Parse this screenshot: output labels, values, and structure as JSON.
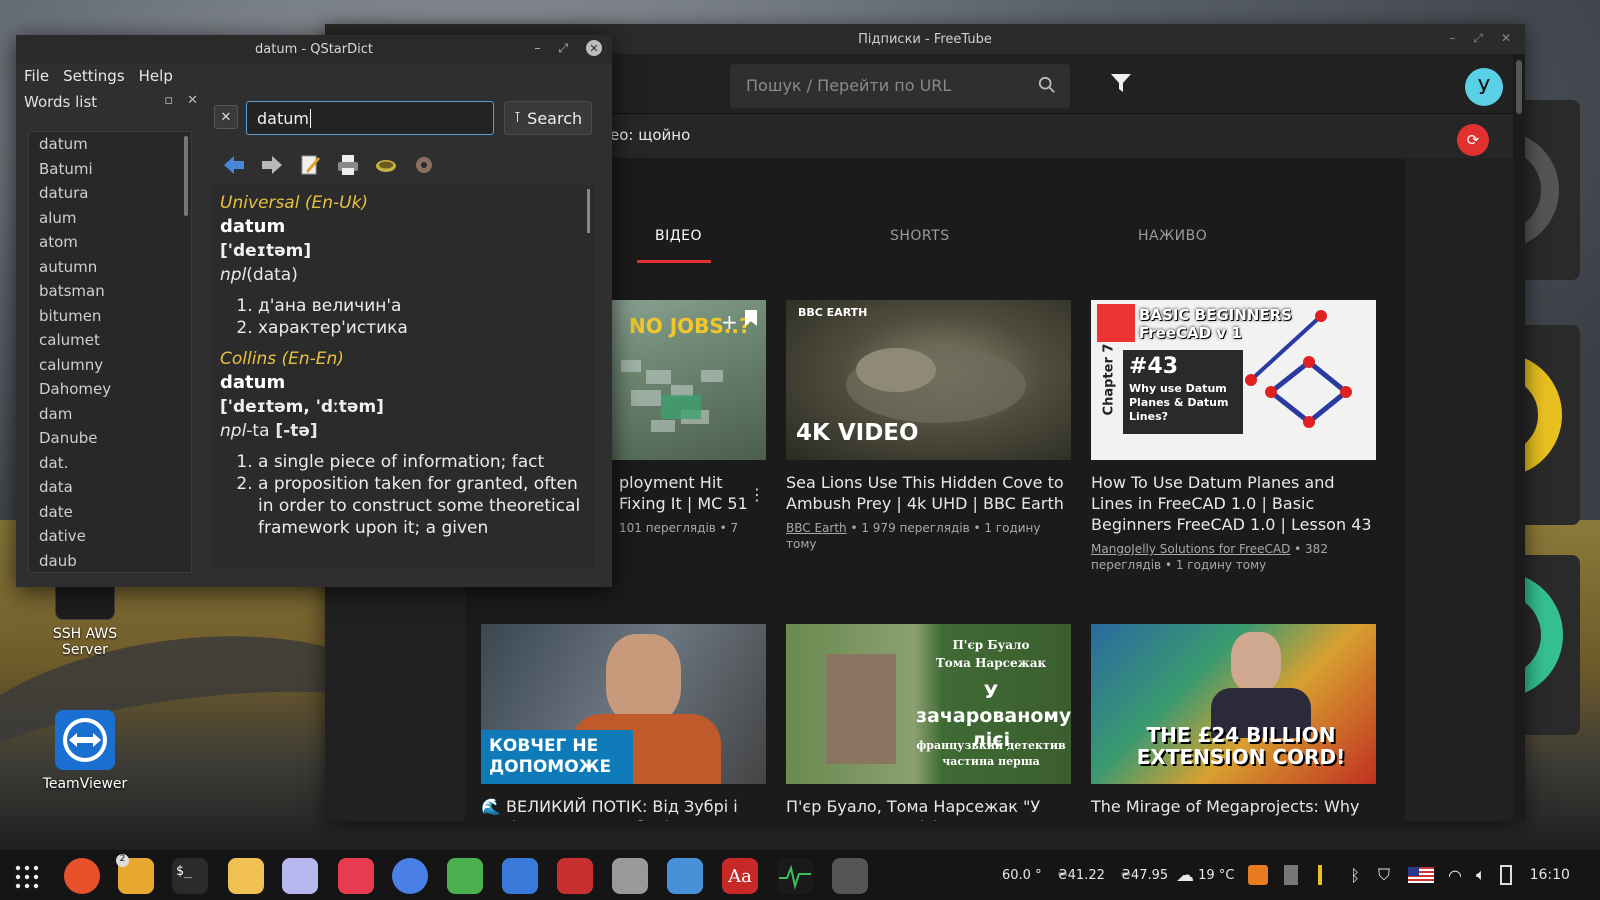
{
  "desktop": {
    "icons": [
      {
        "label": "SSH AWS Server"
      },
      {
        "label": "TeamViewer"
      }
    ]
  },
  "freetube": {
    "window_title": "Підписки - FreeTube",
    "search_placeholder": "Пошук / Перейти по URL",
    "avatar_letter": "У",
    "status_text": "ео: щойно",
    "tabs": [
      "ВІДЕО",
      "SHORTS",
      "НАЖИВО"
    ],
    "videos": [
      {
        "title": "ployment Hit\nFixing It | MC 51",
        "channel": "",
        "meta": "101 переглядів • 7",
        "thumb_text": "NO JOBS..?"
      },
      {
        "title": "Sea Lions Use This Hidden Cove to Ambush Prey | 4k UHD | BBC Earth",
        "channel": "BBC Earth",
        "meta": " • 1 979 переглядів • 1 годину тому",
        "thumb_text": "4K VIDEO",
        "thumb_badge": "BBC EARTH"
      },
      {
        "title": "How To Use Datum Planes and Lines in FreeCAD 1.0 | Basic Beginners FreeCAD 1.0 | Lesson 43",
        "channel": "MangoJelly Solutions for FreeCAD",
        "meta": " • 382 переглядів • 1 годину тому",
        "thumb_text": "BASIC BEGINNERS FreeCAD v 1",
        "thumb_num": "#43",
        "thumb_sub": "Why use Datum Planes & Datum Lines?",
        "thumb_chapter": "Chapter 7"
      },
      {
        "title": "🌊 ВЕЛИКИЙ ПОТІК: Від Зубрі і Сокільник до загибелі",
        "thumb_text": "КОВЧЕГ НЕ ДОПОМОЖЕ"
      },
      {
        "title": "П'єр Буало, Тома Нарсежак \"У зачарованому лісі\", переклад",
        "thumb_top": "П'єр Буало\nТома Нарсежак",
        "thumb_text": "У зачарованому лісі",
        "thumb_sub": "французький детектив\nчастина перша"
      },
      {
        "title": "The Mirage of Megaprojects: Why the West Keeps Getting",
        "thumb_text": "THE £24 BILLION EXTENSION CORD!"
      }
    ]
  },
  "qstardict": {
    "window_title": "datum - QStarDict",
    "menu": [
      "File",
      "Settings",
      "Help"
    ],
    "words_list_title": "Words list",
    "words": [
      "datum",
      "Batumi",
      "datura",
      "alum",
      "atom",
      "autumn",
      "batsman",
      "bitumen",
      "calumet",
      "calumny",
      "Dahomey",
      "dam",
      "Danube",
      "dat.",
      "data",
      "date",
      "dative",
      "daub"
    ],
    "search_value": "datum",
    "search_button": "Search",
    "entries": [
      {
        "dict": "Universal (En-Uk)",
        "word": "datum",
        "transcription": "['deɪtəm]",
        "gram_abbr": "npl",
        "gram_rest": "(data)",
        "senses": [
          "д'ана величин'а",
          "характер'истика"
        ]
      },
      {
        "dict": "Collins (En-En)",
        "word": "datum",
        "transcription": "['deɪtəm, 'dːtəm]",
        "gram_abbr": "npl",
        "gram_rest": "-ta",
        "gram_bold": " [-tə]",
        "senses": [
          "a single piece of information; fact",
          "a proposition taken for granted, often in order to construct some theoretical framework upon it; a given"
        ]
      }
    ]
  },
  "taskbar": {
    "tray": {
      "temp_cpu": "60.0 °",
      "price1": "₴41.22",
      "price2": "₴47.95",
      "weather": "19 °C",
      "clock": "16:10"
    },
    "files_badge": "2"
  }
}
